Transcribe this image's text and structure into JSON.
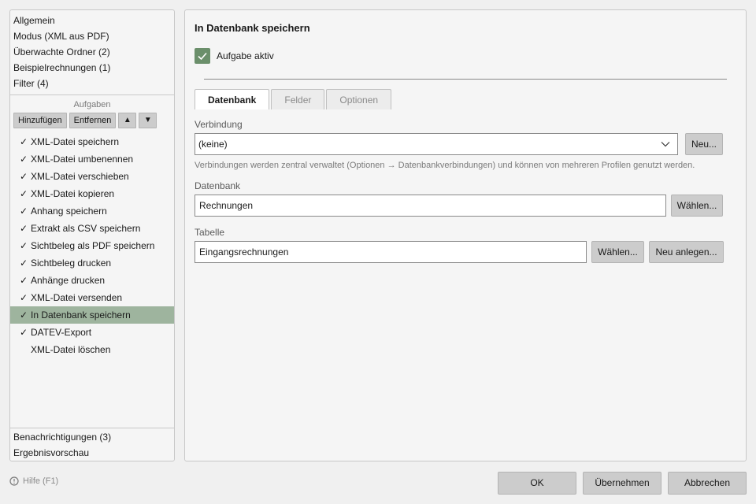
{
  "nav": {
    "top_items": [
      "Allgemein",
      "Modus (XML aus PDF)",
      "Überwachte Ordner (2)",
      "Beispielrechnungen (1)",
      "Filter (4)"
    ],
    "bottom_items": [
      "Benachrichtigungen (3)",
      "Ergebnisvorschau"
    ]
  },
  "tasks": {
    "header": "Aufgaben",
    "add_label": "Hinzufügen",
    "remove_label": "Entfernen",
    "up_label": "▲",
    "down_label": "▼",
    "checkmark": "✓",
    "items": [
      {
        "label": "XML-Datei speichern",
        "checked": true
      },
      {
        "label": "XML-Datei umbenennen",
        "checked": true
      },
      {
        "label": "XML-Datei verschieben",
        "checked": true
      },
      {
        "label": "XML-Datei kopieren",
        "checked": true
      },
      {
        "label": "Anhang speichern",
        "checked": true
      },
      {
        "label": "Extrakt als CSV speichern",
        "checked": true
      },
      {
        "label": "Sichtbeleg als PDF speichern",
        "checked": true
      },
      {
        "label": "Sichtbeleg drucken",
        "checked": true
      },
      {
        "label": "Anhänge drucken",
        "checked": true
      },
      {
        "label": "XML-Datei versenden",
        "checked": true
      },
      {
        "label": "In Datenbank speichern",
        "checked": true,
        "selected": true
      },
      {
        "label": "DATEV-Export",
        "checked": true
      },
      {
        "label": "XML-Datei löschen",
        "checked": false
      }
    ]
  },
  "main": {
    "title": "In Datenbank speichern",
    "active_label": "Aufgabe aktiv",
    "active_checked": true,
    "tabs": [
      "Datenbank",
      "Felder",
      "Optionen"
    ],
    "active_tab": "Datenbank",
    "connection": {
      "label": "Verbindung",
      "value": "(keine)",
      "new_button": "Neu...",
      "hint": "Verbindungen werden zentral verwaltet (Optionen → Datenbankverbindungen) und können von mehreren Profilen genutzt werden."
    },
    "database": {
      "label": "Datenbank",
      "value": "Rechnungen",
      "choose_button": "Wählen..."
    },
    "table": {
      "label": "Tabelle",
      "value": "Eingangsrechnungen",
      "choose_button": "Wählen...",
      "create_button": "Neu anlegen..."
    }
  },
  "footer": {
    "help_label": "Hilfe (F1)",
    "ok_label": "OK",
    "apply_label": "Übernehmen",
    "cancel_label": "Abbrechen"
  },
  "colors": {
    "selection": "#9eb49e",
    "checkbox_accent": "#6b8f6b"
  }
}
